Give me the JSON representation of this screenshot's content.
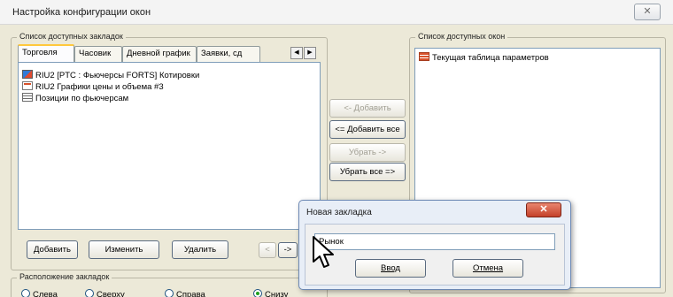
{
  "window": {
    "title": "Настройка конфигурации окон",
    "close_glyph": "✕"
  },
  "available_tabs": {
    "legend": "Список доступных закладок",
    "tabs": [
      {
        "label": "Торговля",
        "active": true
      },
      {
        "label": "Часовик",
        "active": false
      },
      {
        "label": "Дневной график",
        "active": false
      },
      {
        "label": "Заявки, сд",
        "active": false
      }
    ],
    "scroll_left": "◀",
    "scroll_right": "▶",
    "items": [
      {
        "label": "RIU2 [PTC : Фьючерсы FORTS] Котировки",
        "icon": "quotes-icon"
      },
      {
        "label": "RIU2 Графики цены и объема #3",
        "icon": "chart-icon"
      },
      {
        "label": "Позиции по фьючерсам",
        "icon": "table-icon"
      }
    ],
    "buttons": {
      "add": "Добавить",
      "edit": "Изменить",
      "delete": "Удалить",
      "move_left": "<",
      "move_right": "->"
    }
  },
  "transfer_buttons": {
    "add": "<- Добавить",
    "add_all": "<= Добавить все",
    "remove": "Убрать ->",
    "remove_all": "Убрать все =>"
  },
  "available_windows": {
    "legend": "Список доступных окон",
    "items": [
      {
        "label": "Текущая таблица параметров",
        "icon": "params-table-icon"
      }
    ]
  },
  "placement": {
    "legend": "Расположение закладок",
    "options": [
      {
        "label": "Слева",
        "selected": false
      },
      {
        "label": "Сверху",
        "selected": false
      },
      {
        "label": "Справа",
        "selected": false
      },
      {
        "label": "Снизу",
        "selected": true
      }
    ]
  },
  "new_tab_dialog": {
    "title": "Новая закладка",
    "close_glyph": "✕",
    "input_value": "Рынок",
    "ok_button": "Ввод",
    "cancel_button": "Отмена"
  }
}
